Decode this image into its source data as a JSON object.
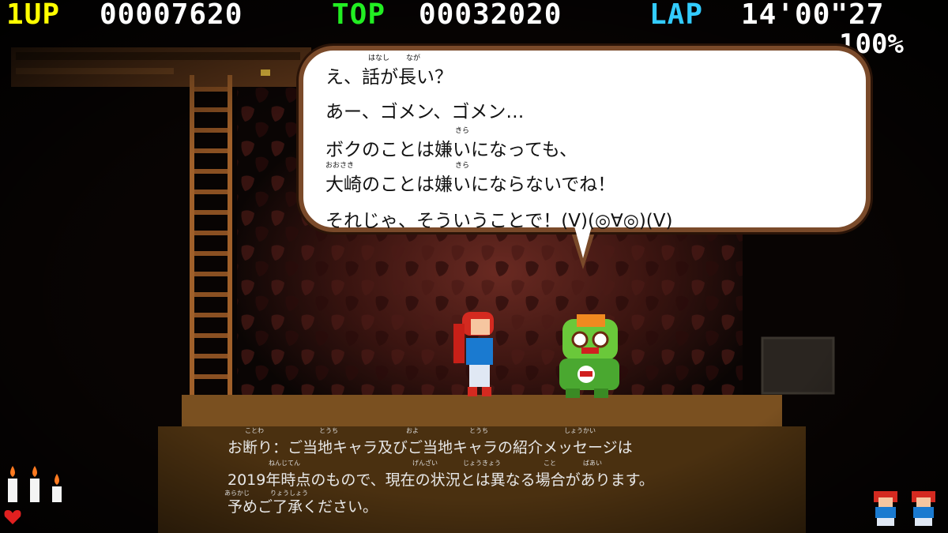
{
  "hud": {
    "player_label": "1UP",
    "player_score": "00007620",
    "top_label": "TOP",
    "top_score": "00032020",
    "lap_label": "LAP",
    "lap_time": "14'00\"27",
    "completion": "100%"
  },
  "dialog": {
    "lines": [
      "え、話が長い？",
      "あー、ゴメン、ゴメン…",
      "ボクのことは嫌いになっても、",
      "大崎のことは嫌いにならないでね！",
      "それじゃ、そういうことで！(V)(◎∀◎)(V)"
    ],
    "ruby": [
      "はなし",
      "なが",
      "きら",
      "おおさき",
      "きら"
    ]
  },
  "caption": {
    "lines": [
      "お断り：ご当地キャラ及びご当地キャラの紹介メッセージは",
      "2019年時点のもので、現在の状況とは異なる場合があります。",
      "予めご了承ください。"
    ],
    "ruby": [
      "ことわ",
      "とうち",
      "およ",
      "とうち",
      "しょうかい",
      "ねんじてん",
      "げんざい",
      "じょうきょう",
      "こと",
      "ばあい",
      "あらかじ",
      "りょうしょう"
    ]
  },
  "status": {
    "candles": 3,
    "hearts": 1,
    "lives": 2
  },
  "colors": {
    "player_label": "#ffff00",
    "top_label": "#22ee22",
    "lap_label": "#33ccff",
    "score_text": "#ffffff",
    "bubble_border": "#7a4a2a",
    "heart": "#e02020"
  }
}
